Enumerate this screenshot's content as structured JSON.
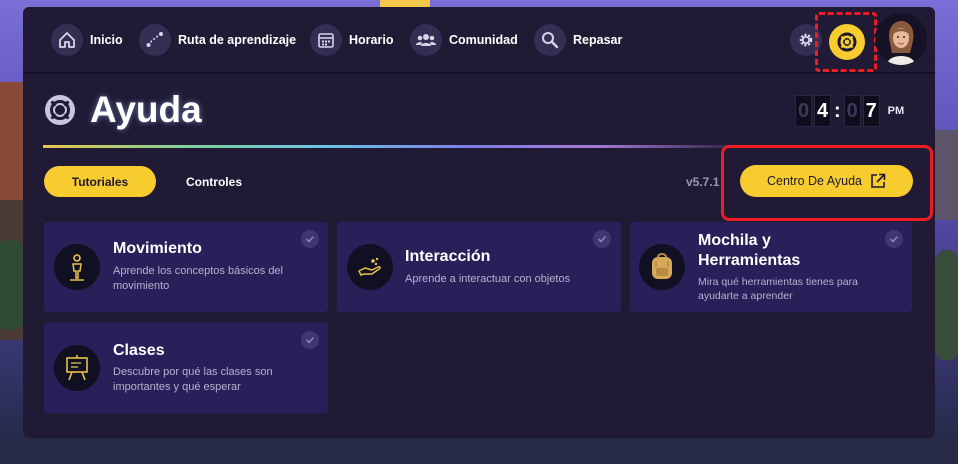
{
  "nav": {
    "items": [
      {
        "label": "Inicio",
        "icon": "home-icon"
      },
      {
        "label": "Ruta de aprendizaje",
        "icon": "route-icon"
      },
      {
        "label": "Horario",
        "icon": "calendar-icon"
      },
      {
        "label": "Comunidad",
        "icon": "community-icon"
      },
      {
        "label": "Repasar",
        "icon": "search-icon"
      }
    ]
  },
  "page": {
    "title": "Ayuda",
    "version": "v5.7.1"
  },
  "clock": {
    "d1": "0",
    "d2": "4",
    "d3": "0",
    "d4": "7",
    "ampm": "PM"
  },
  "tabs": {
    "tutoriales": "Tutoriales",
    "controles": "Controles"
  },
  "help_center": {
    "label": "Centro De Ayuda"
  },
  "cards": [
    {
      "title": "Movimiento",
      "desc": "Aprende los conceptos básicos del movimiento",
      "icon": "person-icon"
    },
    {
      "title": "Interacción",
      "desc": "Aprende a interactuar con objetos",
      "icon": "hand-icon"
    },
    {
      "title": "Mochila y Herramientas",
      "desc": "Mira qué herramientas tienes para ayudarte a aprender",
      "icon": "backpack-icon"
    },
    {
      "title": "Clases",
      "desc": "Descubre por qué las clases son importantes y qué esperar",
      "icon": "easel-icon"
    }
  ],
  "colors": {
    "accent": "#f7cc2e",
    "panel": "#201a35",
    "card": "#282159",
    "highlight": "#ee1c25"
  }
}
